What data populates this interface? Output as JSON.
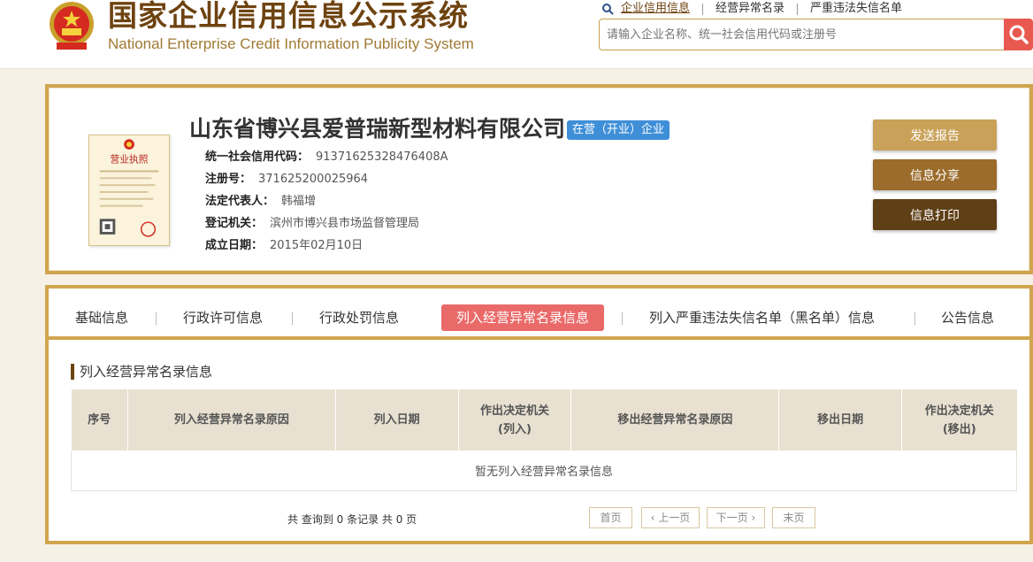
{
  "site": {
    "title_cn": "国家企业信用信息公示系统",
    "title_en": "National Enterprise Credit Information Publicity System"
  },
  "top_links": [
    "企业信用信息",
    "经营异常名录",
    "严重违法失信名单"
  ],
  "search": {
    "placeholder": "请输入企业名称、统一社会信用代码或注册号"
  },
  "company": {
    "name": "山东省博兴县爱普瑞新型材料有限公司",
    "status": "在营（开业）企业",
    "license_label": "营业执照",
    "fields": [
      {
        "label": "统一社会信用代码：",
        "value": "91371625328476408A"
      },
      {
        "label": "注册号：",
        "value": "371625200025964"
      },
      {
        "label": "法定代表人：",
        "value": "韩福增"
      },
      {
        "label": "登记机关：",
        "value": "滨州市博兴县市场监督管理局"
      },
      {
        "label": "成立日期：",
        "value": "2015年02月10日"
      }
    ]
  },
  "actions": {
    "send_report": "发送报告",
    "share": "信息分享",
    "print": "信息打印"
  },
  "tabs": [
    "基础信息",
    "行政许可信息",
    "行政处罚信息",
    "列入经营异常名录信息",
    "列入严重违法失信名单（黑名单）信息",
    "公告信息"
  ],
  "active_tab": "列入经营异常名录信息",
  "section": {
    "title": "列入经营异常名录信息",
    "columns": [
      "序号",
      "列入经营异常名录原因",
      "列入日期",
      "作出决定机关\n(列入)",
      "移出经营异常名录原因",
      "移出日期",
      "作出决定机关\n(移出)"
    ],
    "empty_message": "暂无列入经营异常名录信息"
  },
  "pagination": {
    "summary": "共 查询到 0 条记录 共 0 页",
    "first": "首页",
    "prev": "上一页",
    "next": "下一页",
    "last": "末页"
  },
  "colors": {
    "brand_brown": "#6e4310",
    "gold_border": "#d0a54f",
    "active_tab": "#ea6a6a",
    "status_badge": "#3f8fd8",
    "search_button": "#e85a4f"
  }
}
